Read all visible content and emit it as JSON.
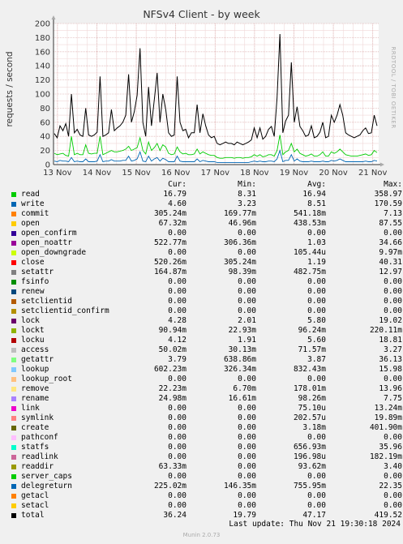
{
  "chart_data": {
    "type": "line",
    "title": "NFSv4 Client - by week",
    "ylabel": "requests / second",
    "ylim": [
      0,
      200
    ],
    "yticks": [
      0,
      20,
      40,
      60,
      80,
      100,
      120,
      140,
      160,
      180,
      200
    ],
    "xticks": [
      "13 Nov",
      "14 Nov",
      "15 Nov",
      "16 Nov",
      "17 Nov",
      "18 Nov",
      "19 Nov",
      "20 Nov",
      "21 Nov"
    ],
    "grid": true,
    "columns": [
      "Cur:",
      "Min:",
      "Avg:",
      "Max:"
    ],
    "legend": [
      {
        "name": "read",
        "color": "#00cc00",
        "cur": "16.79",
        "min": "8.31",
        "avg": "16.94",
        "max": "358.97"
      },
      {
        "name": "write",
        "color": "#0066b3",
        "cur": "4.60",
        "min": "3.23",
        "avg": "8.51",
        "max": "170.59"
      },
      {
        "name": "commit",
        "color": "#ff8000",
        "cur": "305.24m",
        "min": "169.77m",
        "avg": "541.18m",
        "max": "7.13"
      },
      {
        "name": "open",
        "color": "#ffcc00",
        "cur": "67.32m",
        "min": "46.96m",
        "avg": "438.53m",
        "max": "87.55"
      },
      {
        "name": "open_confirm",
        "color": "#330099",
        "cur": "0.00",
        "min": "0.00",
        "avg": "0.00",
        "max": "0.00"
      },
      {
        "name": "open_noattr",
        "color": "#990099",
        "cur": "522.77m",
        "min": "306.36m",
        "avg": "1.03",
        "max": "34.66"
      },
      {
        "name": "open_downgrade",
        "color": "#ccff00",
        "cur": "0.00",
        "min": "0.00",
        "avg": "105.44u",
        "max": "9.97m"
      },
      {
        "name": "close",
        "color": "#ff0000",
        "cur": "520.26m",
        "min": "305.24m",
        "avg": "1.19",
        "max": "40.31"
      },
      {
        "name": "setattr",
        "color": "#808080",
        "cur": "164.87m",
        "min": "98.39m",
        "avg": "482.75m",
        "max": "12.97"
      },
      {
        "name": "fsinfo",
        "color": "#008f00",
        "cur": "0.00",
        "min": "0.00",
        "avg": "0.00",
        "max": "0.00"
      },
      {
        "name": "renew",
        "color": "#00487d",
        "cur": "0.00",
        "min": "0.00",
        "avg": "0.00",
        "max": "0.00"
      },
      {
        "name": "setclientid",
        "color": "#b35a00",
        "cur": "0.00",
        "min": "0.00",
        "avg": "0.00",
        "max": "0.00"
      },
      {
        "name": "setclientid_confirm",
        "color": "#b38f00",
        "cur": "0.00",
        "min": "0.00",
        "avg": "0.00",
        "max": "0.00"
      },
      {
        "name": "lock",
        "color": "#6b006b",
        "cur": "4.28",
        "min": "2.01",
        "avg": "5.80",
        "max": "19.02"
      },
      {
        "name": "lockt",
        "color": "#8fb300",
        "cur": "90.94m",
        "min": "22.93m",
        "avg": "96.24m",
        "max": "220.11m"
      },
      {
        "name": "locku",
        "color": "#b30000",
        "cur": "4.12",
        "min": "1.91",
        "avg": "5.60",
        "max": "18.81"
      },
      {
        "name": "access",
        "color": "#bebebe",
        "cur": "50.02m",
        "min": "30.13m",
        "avg": "71.57m",
        "max": "3.27"
      },
      {
        "name": "getattr",
        "color": "#80ff80",
        "cur": "3.79",
        "min": "638.86m",
        "avg": "3.87",
        "max": "36.13"
      },
      {
        "name": "lookup",
        "color": "#80c9ff",
        "cur": "602.23m",
        "min": "326.34m",
        "avg": "832.43m",
        "max": "15.98"
      },
      {
        "name": "lookup_root",
        "color": "#ffc080",
        "cur": "0.00",
        "min": "0.00",
        "avg": "0.00",
        "max": "0.00"
      },
      {
        "name": "remove",
        "color": "#ffe680",
        "cur": "22.23m",
        "min": "6.70m",
        "avg": "178.01m",
        "max": "13.96"
      },
      {
        "name": "rename",
        "color": "#aa80ff",
        "cur": "24.98m",
        "min": "16.61m",
        "avg": "98.26m",
        "max": "7.75"
      },
      {
        "name": "link",
        "color": "#ee00cc",
        "cur": "0.00",
        "min": "0.00",
        "avg": "75.10u",
        "max": "13.24m"
      },
      {
        "name": "symlink",
        "color": "#ff8080",
        "cur": "0.00",
        "min": "0.00",
        "avg": "202.57u",
        "max": "19.89m"
      },
      {
        "name": "create",
        "color": "#666600",
        "cur": "0.00",
        "min": "0.00",
        "avg": "3.18m",
        "max": "401.90m"
      },
      {
        "name": "pathconf",
        "color": "#ffbfff",
        "cur": "0.00",
        "min": "0.00",
        "avg": "0.00",
        "max": "0.00"
      },
      {
        "name": "statfs",
        "color": "#00ffcc",
        "cur": "0.00",
        "min": "0.00",
        "avg": "656.93m",
        "max": "35.96"
      },
      {
        "name": "readlink",
        "color": "#cc6699",
        "cur": "0.00",
        "min": "0.00",
        "avg": "196.98u",
        "max": "182.19m"
      },
      {
        "name": "readdir",
        "color": "#999900",
        "cur": "63.33m",
        "min": "0.00",
        "avg": "93.62m",
        "max": "3.40"
      },
      {
        "name": "server_caps",
        "color": "#00cc00",
        "cur": "0.00",
        "min": "0.00",
        "avg": "0.00",
        "max": "0.00"
      },
      {
        "name": "delegreturn",
        "color": "#0066b3",
        "cur": "225.02m",
        "min": "146.35m",
        "avg": "755.95m",
        "max": "22.35"
      },
      {
        "name": "getacl",
        "color": "#ff8000",
        "cur": "0.00",
        "min": "0.00",
        "avg": "0.00",
        "max": "0.00"
      },
      {
        "name": "setacl",
        "color": "#ffcc00",
        "cur": "0.00",
        "min": "0.00",
        "avg": "0.00",
        "max": "0.00"
      },
      {
        "name": "total",
        "color": "#000000",
        "cur": "36.24",
        "min": "19.79",
        "avg": "47.17",
        "max": "419.52"
      }
    ],
    "series": [
      {
        "name": "total",
        "color": "#000000",
        "values": [
          44,
          38,
          55,
          48,
          58,
          40,
          100,
          45,
          50,
          42,
          40,
          80,
          42,
          40,
          42,
          46,
          125,
          40,
          42,
          45,
          78,
          48,
          52,
          55,
          60,
          70,
          128,
          60,
          75,
          98,
          165,
          60,
          40,
          110,
          55,
          92,
          130,
          60,
          100,
          78,
          45,
          40,
          42,
          125,
          60,
          48,
          50,
          38,
          45,
          45,
          85,
          45,
          72,
          55,
          42,
          38,
          40,
          30,
          28,
          30,
          32,
          30,
          30,
          28,
          32,
          30,
          28,
          30,
          32,
          35,
          52,
          38,
          52,
          36,
          40,
          50,
          54,
          40,
          95,
          185,
          45,
          62,
          70,
          145,
          60,
          82,
          54,
          48,
          40,
          42,
          55,
          38,
          40,
          46,
          60,
          38,
          40,
          70,
          60,
          70,
          85,
          70,
          45,
          42,
          40,
          38,
          40,
          42,
          48,
          52,
          44,
          45,
          70,
          55
        ]
      },
      {
        "name": "read",
        "color": "#00cc00",
        "values": [
          16,
          14,
          15,
          16,
          13,
          12,
          40,
          14,
          16,
          14,
          14,
          28,
          16,
          15,
          16,
          16,
          40,
          14,
          16,
          18,
          20,
          18,
          18,
          19,
          20,
          22,
          26,
          20,
          22,
          24,
          38,
          20,
          15,
          32,
          20,
          24,
          30,
          20,
          28,
          25,
          16,
          14,
          15,
          25,
          18,
          15,
          16,
          14,
          14,
          15,
          22,
          15,
          18,
          16,
          14,
          13,
          13,
          10,
          9,
          9,
          10,
          10,
          10,
          9,
          10,
          10,
          9,
          10,
          10,
          11,
          14,
          12,
          14,
          11,
          12,
          14,
          14,
          12,
          20,
          42,
          14,
          18,
          20,
          30,
          18,
          22,
          16,
          14,
          12,
          13,
          15,
          12,
          12,
          14,
          18,
          12,
          12,
          18,
          16,
          18,
          22,
          18,
          14,
          13,
          12,
          12,
          12,
          13,
          14,
          15,
          13,
          14,
          20,
          17
        ]
      },
      {
        "name": "write",
        "color": "#0066b3",
        "values": [
          5,
          4,
          6,
          5,
          5,
          4,
          10,
          4,
          5,
          4,
          4,
          8,
          4,
          4,
          4,
          5,
          14,
          4,
          5,
          5,
          7,
          5,
          5,
          5,
          6,
          6,
          12,
          5,
          6,
          8,
          18,
          5,
          4,
          12,
          5,
          8,
          10,
          5,
          9,
          7,
          4,
          4,
          4,
          12,
          5,
          4,
          4,
          4,
          4,
          4,
          8,
          4,
          6,
          5,
          4,
          4,
          4,
          3,
          3,
          3,
          3,
          3,
          3,
          3,
          3,
          3,
          3,
          3,
          3,
          4,
          5,
          4,
          5,
          4,
          4,
          5,
          5,
          4,
          8,
          20,
          4,
          6,
          6,
          14,
          5,
          8,
          5,
          4,
          4,
          4,
          5,
          4,
          4,
          4,
          5,
          4,
          4,
          6,
          5,
          6,
          8,
          6,
          4,
          4,
          4,
          4,
          4,
          4,
          4,
          5,
          4,
          4,
          6,
          5
        ]
      }
    ]
  },
  "footer": {
    "last_update": "Last update: Thu Nov 21 19:30:18 2024",
    "version": "Munin 2.0.73",
    "watermark": "RRDTOOL / TOBI OETIKER"
  }
}
